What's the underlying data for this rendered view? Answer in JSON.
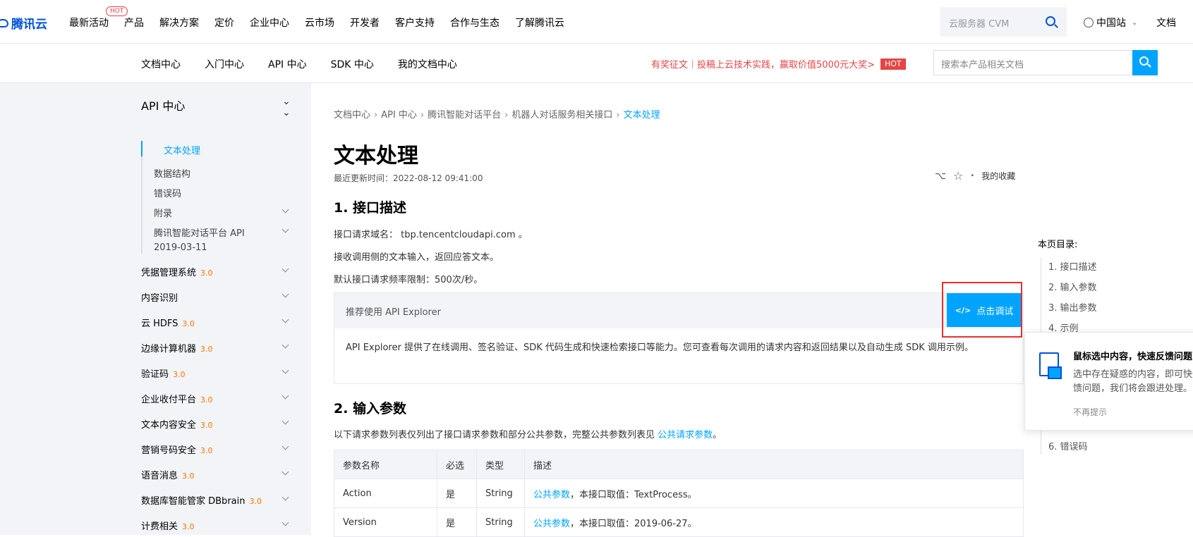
{
  "topnav": {
    "logo": "腾讯云",
    "items": [
      "最新活动",
      "产品",
      "解决方案",
      "定价",
      "企业中心",
      "云市场",
      "开发者",
      "客户支持",
      "合作与生态",
      "了解腾讯云"
    ],
    "hot_badge": "HOT",
    "search_placeholder": "云服务器 CVM",
    "region": "中国站",
    "docs": "文档"
  },
  "subnav": {
    "items": [
      "文档中心",
      "入门中心",
      "API 中心",
      "SDK 中心",
      "我的文档中心"
    ],
    "promo": "有奖征文｜投稿上云技术实践，赢取价值5000元大奖>",
    "promo_badge": "HOT",
    "search_placeholder": "搜索本产品相关文档"
  },
  "sidebar": {
    "title": "API 中心",
    "sub_items": [
      {
        "label": "文本处理",
        "active": true
      },
      {
        "label": "数据结构"
      },
      {
        "label": "错误码"
      },
      {
        "label": "附录"
      },
      {
        "label": "腾讯智能对话平台 API"
      },
      {
        "label": "2019-03-11"
      }
    ],
    "categories": [
      {
        "label": "凭据管理系统",
        "version": "3.0"
      },
      {
        "label": "内容识别",
        "version": ""
      },
      {
        "label": "云 HDFS",
        "version": "3.0"
      },
      {
        "label": "边缘计算机器",
        "version": "3.0"
      },
      {
        "label": "验证码",
        "version": "3.0"
      },
      {
        "label": "企业收付平台",
        "version": "3.0"
      },
      {
        "label": "文本内容安全",
        "version": "3.0"
      },
      {
        "label": "营销号码安全",
        "version": "3.0"
      },
      {
        "label": "语音消息",
        "version": "3.0"
      },
      {
        "label": "数据库智能管家 DBbrain",
        "version": "3.0"
      },
      {
        "label": "计费相关",
        "version": "3.0"
      }
    ]
  },
  "breadcrumb": [
    "文档中心",
    "API 中心",
    "腾讯智能对话平台",
    "机器人对话服务相关接口",
    "文本处理"
  ],
  "main": {
    "title": "文本处理",
    "updated": "最近更新时间：2022-08-12 09:41:00",
    "favorite": "我的收藏",
    "section1_title": "1. 接口描述",
    "p1": "接口请求域名： tbp.tencentcloudapi.com 。",
    "p2": "接收调用侧的文本输入，返回应答文本。",
    "p3": "默认接口请求频率限制：500次/秒。",
    "explorer_label": "推荐使用 API Explorer",
    "explorer_button": "点击调试",
    "explorer_code_icon": "</>",
    "explorer_desc": "API Explorer 提供了在线调用、签名验证、SDK 代码生成和快速检索接口等能力。您可查看每次调用的请求内容和返回结果以及自动生成 SDK 调用示例。",
    "section2_title": "2. 输入参数",
    "p4_prefix": "以下请求参数列表仅列出了接口请求参数和部分公共参数，完整公共参数列表见 ",
    "p4_link": "公共请求参数",
    "p4_suffix": "。",
    "table": {
      "headers": [
        "参数名称",
        "必选",
        "类型",
        "描述"
      ],
      "rows": [
        {
          "name": "Action",
          "required": "是",
          "type": "String",
          "link": "公共参数",
          "desc": "，本接口取值：TextProcess。"
        },
        {
          "name": "Version",
          "required": "是",
          "type": "String",
          "link": "公共参数",
          "desc": "，本接口取值：2019-06-27。"
        }
      ]
    }
  },
  "toc": {
    "title": "本页目录:",
    "items": [
      "1. 接口描述",
      "2. 输入参数",
      "3. 输出参数",
      "4. 示例",
      "6. 错误码"
    ]
  },
  "popup": {
    "title": "鼠标选中内容，快速反馈问题",
    "body": "选中存在疑惑的内容，即可快速反馈问题，我们将会跟进处理。",
    "dismiss": "不再提示"
  },
  "colors": {
    "accent": "#00a4ff",
    "brand": "#0052d9",
    "hot": "#e54545",
    "version": "#ff7200"
  }
}
